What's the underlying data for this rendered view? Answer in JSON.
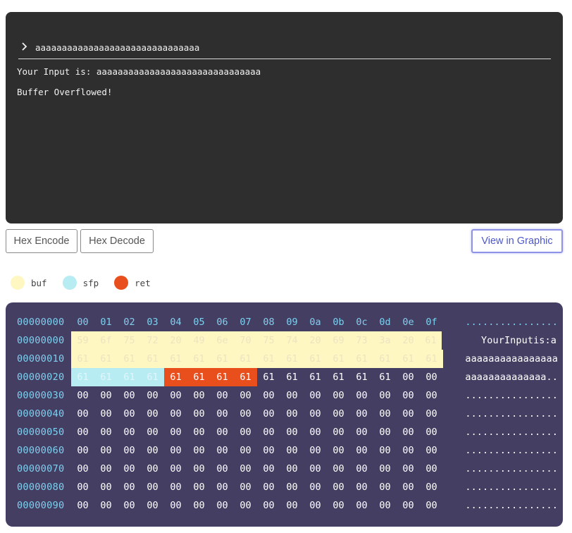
{
  "terminal": {
    "command": "aaaaaaaaaaaaaaaaaaaaaaaaaaaaaaa",
    "output": [
      "Your Input is: aaaaaaaaaaaaaaaaaaaaaaaaaaaaaaa",
      "Buffer Overflowed!"
    ]
  },
  "buttons": {
    "hex_encode": "Hex Encode",
    "hex_decode": "Hex Decode",
    "view_graphic": "View in Graphic"
  },
  "legend": [
    {
      "label": "buf",
      "color": "#fff7c2"
    },
    {
      "label": "sfp",
      "color": "#b7ecf3"
    },
    {
      "label": "ret",
      "color": "#e84f1d"
    }
  ],
  "hex": {
    "header": {
      "addr": "00000000",
      "cols": [
        "00",
        "01",
        "02",
        "03",
        "04",
        "05",
        "06",
        "07",
        "08",
        "09",
        "0a",
        "0b",
        "0c",
        "0d",
        "0e",
        "0f"
      ],
      "ascii": "................"
    },
    "rows": [
      {
        "addr": "00000000",
        "bytes": [
          "59",
          "6f",
          "75",
          "72",
          "20",
          "49",
          "6e",
          "70",
          "75",
          "74",
          "20",
          "69",
          "73",
          "3a",
          "20",
          "61"
        ],
        "regions": [
          "buf",
          "buf",
          "buf",
          "buf",
          "buf",
          "buf",
          "buf",
          "buf",
          "buf",
          "buf",
          "buf",
          "buf",
          "buf",
          "buf",
          "buf",
          "buf"
        ],
        "ascii": "YourInputis:a"
      },
      {
        "addr": "00000010",
        "bytes": [
          "61",
          "61",
          "61",
          "61",
          "61",
          "61",
          "61",
          "61",
          "61",
          "61",
          "61",
          "61",
          "61",
          "61",
          "61",
          "61"
        ],
        "regions": [
          "buf",
          "buf",
          "buf",
          "buf",
          "buf",
          "buf",
          "buf",
          "buf",
          "buf",
          "buf",
          "buf",
          "buf",
          "buf",
          "buf",
          "buf",
          "buf"
        ],
        "ascii": "aaaaaaaaaaaaaaaa"
      },
      {
        "addr": "00000020",
        "bytes": [
          "61",
          "61",
          "61",
          "61",
          "61",
          "61",
          "61",
          "61",
          "61",
          "61",
          "61",
          "61",
          "61",
          "61",
          "00",
          "00"
        ],
        "regions": [
          "sfp",
          "sfp",
          "sfp",
          "sfp",
          "ret",
          "ret",
          "ret",
          "ret",
          "",
          "",
          "",
          "",
          "",
          "",
          "",
          ""
        ],
        "ascii": "aaaaaaaaaaaaaa.."
      },
      {
        "addr": "00000030",
        "bytes": [
          "00",
          "00",
          "00",
          "00",
          "00",
          "00",
          "00",
          "00",
          "00",
          "00",
          "00",
          "00",
          "00",
          "00",
          "00",
          "00"
        ],
        "regions": [],
        "ascii": "................"
      },
      {
        "addr": "00000040",
        "bytes": [
          "00",
          "00",
          "00",
          "00",
          "00",
          "00",
          "00",
          "00",
          "00",
          "00",
          "00",
          "00",
          "00",
          "00",
          "00",
          "00"
        ],
        "regions": [],
        "ascii": "................"
      },
      {
        "addr": "00000050",
        "bytes": [
          "00",
          "00",
          "00",
          "00",
          "00",
          "00",
          "00",
          "00",
          "00",
          "00",
          "00",
          "00",
          "00",
          "00",
          "00",
          "00"
        ],
        "regions": [],
        "ascii": "................"
      },
      {
        "addr": "00000060",
        "bytes": [
          "00",
          "00",
          "00",
          "00",
          "00",
          "00",
          "00",
          "00",
          "00",
          "00",
          "00",
          "00",
          "00",
          "00",
          "00",
          "00"
        ],
        "regions": [],
        "ascii": "................"
      },
      {
        "addr": "00000070",
        "bytes": [
          "00",
          "00",
          "00",
          "00",
          "00",
          "00",
          "00",
          "00",
          "00",
          "00",
          "00",
          "00",
          "00",
          "00",
          "00",
          "00"
        ],
        "regions": [],
        "ascii": "................"
      },
      {
        "addr": "00000080",
        "bytes": [
          "00",
          "00",
          "00",
          "00",
          "00",
          "00",
          "00",
          "00",
          "00",
          "00",
          "00",
          "00",
          "00",
          "00",
          "00",
          "00"
        ],
        "regions": [],
        "ascii": "................"
      },
      {
        "addr": "00000090",
        "bytes": [
          "00",
          "00",
          "00",
          "00",
          "00",
          "00",
          "00",
          "00",
          "00",
          "00",
          "00",
          "00",
          "00",
          "00",
          "00",
          "00"
        ],
        "regions": [],
        "ascii": "................"
      }
    ]
  }
}
